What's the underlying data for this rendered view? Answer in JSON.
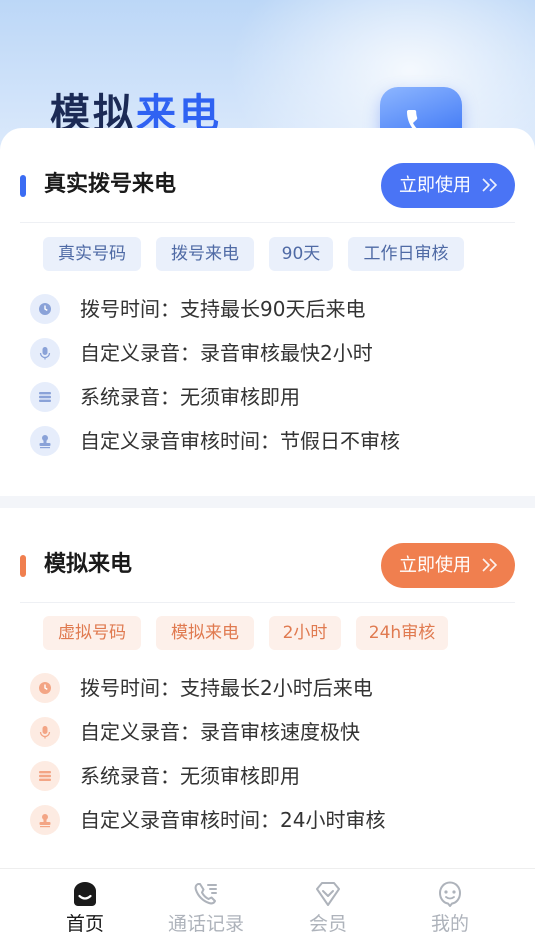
{
  "hero": {
    "title_part1": "模拟",
    "title_part2": "来电"
  },
  "sections": [
    {
      "title": "真实拨号来电",
      "button_label": "立即使用",
      "accent_color": "#3b6cf3",
      "tags": [
        "真实号码",
        "拨号来电",
        "90天",
        "工作日审核"
      ],
      "features": [
        {
          "icon": "clock-icon",
          "text": "拨号时间：支持最长90天后来电"
        },
        {
          "icon": "microphone-icon",
          "text": "自定义录音：录音审核最快2小时"
        },
        {
          "icon": "list-icon",
          "text": "系统录音：无须审核即用"
        },
        {
          "icon": "stamp-icon",
          "text": "自定义录音审核时间：节假日不审核"
        }
      ]
    },
    {
      "title": "模拟来电",
      "button_label": "立即使用",
      "accent_color": "#f07f4f",
      "tags": [
        "虚拟号码",
        "模拟来电",
        "2小时",
        "24h审核"
      ],
      "features": [
        {
          "icon": "clock-icon",
          "text": "拨号时间：支持最长2小时后来电"
        },
        {
          "icon": "microphone-icon",
          "text": "自定义录音：录音审核速度极快"
        },
        {
          "icon": "list-icon",
          "text": "系统录音：无须审核即用"
        },
        {
          "icon": "stamp-icon",
          "text": "自定义录音审核时间：24小时审核"
        }
      ]
    }
  ],
  "tabbar": {
    "items": [
      {
        "icon": "home-icon",
        "label": "首页",
        "active": true
      },
      {
        "icon": "call-log-icon",
        "label": "通话记录",
        "active": false
      },
      {
        "icon": "vip-diamond-icon",
        "label": "会员",
        "active": false
      },
      {
        "icon": "profile-icon",
        "label": "我的",
        "active": false
      }
    ]
  }
}
